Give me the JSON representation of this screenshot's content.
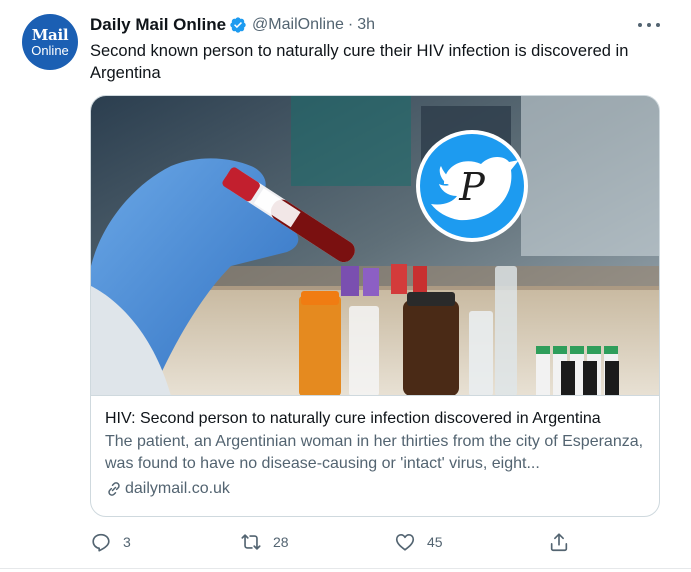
{
  "author": {
    "display_name": "Daily Mail Online",
    "handle": "@MailOnline",
    "separator": "·",
    "time": "3h",
    "avatar_line1": "Mail",
    "avatar_line2": "Online",
    "verified_icon": "verified-badge-icon",
    "avatar_color": "#1b5fb3"
  },
  "tweet": {
    "text": "Second known person to naturally cure their HIV infection is discovered in Argentina"
  },
  "card": {
    "title": "HIV: Second person to naturally cure infection discovered in Argentina",
    "description": "The patient, an Argentinian woman in her thirties from the city of Esperanza, was found to have no disease-causing or 'intact' virus, eight...",
    "domain": "dailymail.co.uk",
    "image_overlay_letter": "P"
  },
  "actions": {
    "reply_count": "3",
    "retweet_count": "28",
    "like_count": "45"
  },
  "colors": {
    "twitter_blue": "#1d9bf0",
    "secondary_text": "#536471",
    "border": "#cfd9de"
  }
}
